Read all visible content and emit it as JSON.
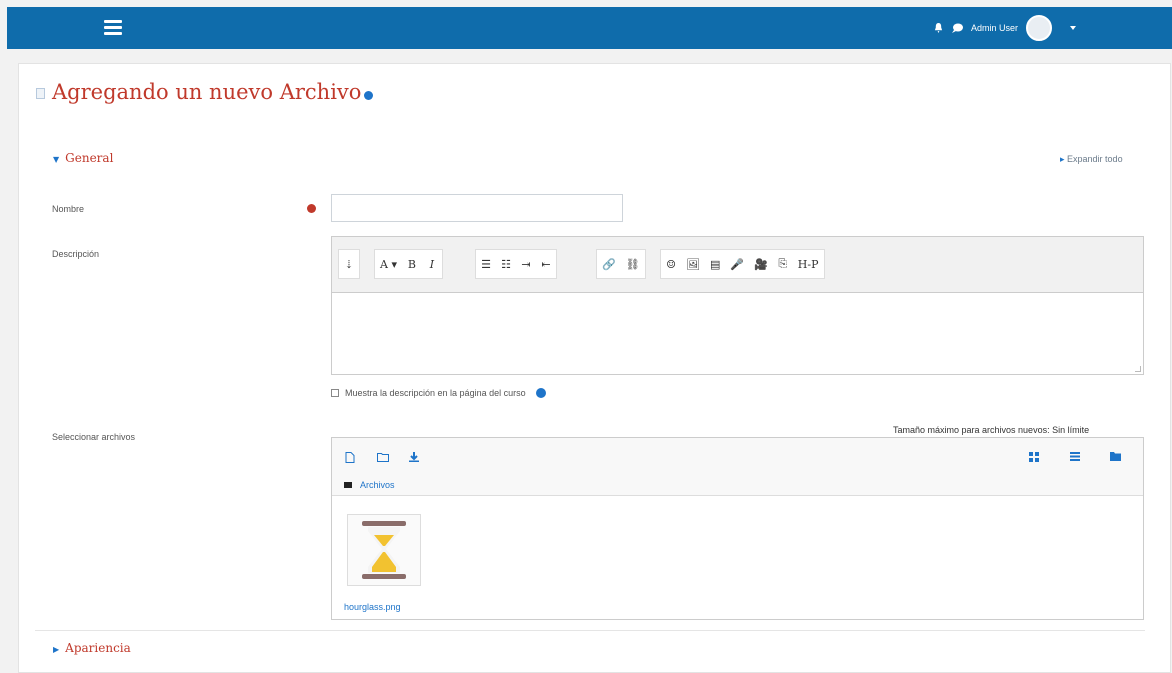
{
  "topbar": {
    "user_name": "Admin User",
    "icons": [
      "menu-icon",
      "bell-icon",
      "chat-icon"
    ]
  },
  "page": {
    "title": "Agregando un nuevo Archivo",
    "expand_all": "Expandir todo"
  },
  "sections": {
    "general": "General",
    "appearance": "Apariencia"
  },
  "form": {
    "name_label": "Nombre",
    "name_value": "",
    "description_label": "Descripción",
    "show_description": "Muestra la descripción en la página del curso",
    "select_files_label": "Seleccionar archivos",
    "max_size": "Tamaño máximo para archivos nuevos: Sin límite"
  },
  "editor": {
    "toolbar": {
      "g1": [
        "⇣"
      ],
      "g2": [
        "A ▾",
        "B",
        "I"
      ],
      "g3": [
        "☰",
        "☷",
        "⇥",
        "⇤"
      ],
      "g4": [
        "🔗",
        "⛓"
      ],
      "g5": [
        "☺",
        "🖼",
        "▤",
        "🎤",
        "🎥",
        "⎘",
        "H-P"
      ]
    }
  },
  "filemanager": {
    "path_label": "Archivos",
    "file_name": "hourglass.png"
  },
  "colors": {
    "topbar": "#0f6cab",
    "accent_red": "#c0392b",
    "link_blue": "#1e74c9"
  }
}
